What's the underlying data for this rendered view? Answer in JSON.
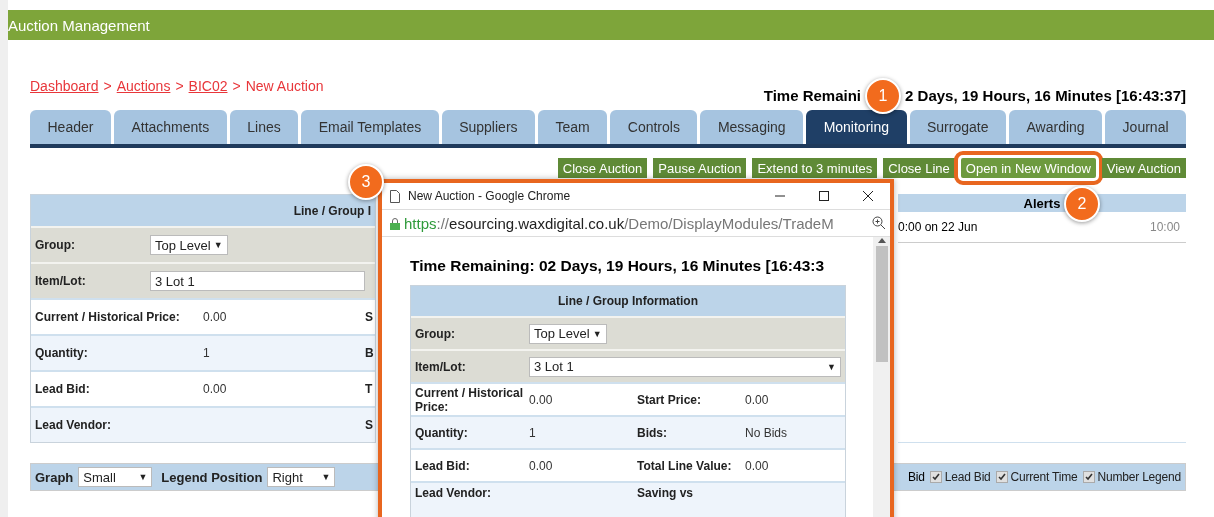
{
  "app_bar": {
    "title": "Auction Management"
  },
  "breadcrumb": [
    {
      "label": "Dashboard",
      "link": true
    },
    {
      "label": "Auctions",
      "link": true
    },
    {
      "label": "BIC02",
      "link": true
    },
    {
      "label": "New Auction",
      "link": false
    }
  ],
  "breadcrumb_separator": ">",
  "time_remaining": {
    "before_callout": "Time Remaini",
    "after_callout": "2 Days, 19 Hours, 16 Minutes [16:43:37]"
  },
  "tabs": [
    {
      "label": "Header",
      "selected": false
    },
    {
      "label": "Attachments",
      "selected": false
    },
    {
      "label": "Lines",
      "selected": false
    },
    {
      "label": "Email Templates",
      "selected": false
    },
    {
      "label": "Suppliers",
      "selected": false
    },
    {
      "label": "Team",
      "selected": false
    },
    {
      "label": "Controls",
      "selected": false
    },
    {
      "label": "Messaging",
      "selected": false
    },
    {
      "label": "Monitoring",
      "selected": true
    },
    {
      "label": "Surrogate",
      "selected": false
    },
    {
      "label": "Awarding",
      "selected": false
    },
    {
      "label": "Journal",
      "selected": false
    }
  ],
  "actions": [
    {
      "label": "Close Auction",
      "highlighted": false
    },
    {
      "label": "Pause Auction",
      "highlighted": false
    },
    {
      "label": "Extend to 3 minutes",
      "highlighted": false
    },
    {
      "label": "Close Line",
      "highlighted": false
    },
    {
      "label": "Open in New Window",
      "highlighted": true
    },
    {
      "label": "View Auction",
      "highlighted": false
    }
  ],
  "line_panel": {
    "title": "Line / Group I",
    "rows": [
      {
        "kind": "select",
        "label": "Group:",
        "value": "Top Level",
        "caret": "▼"
      },
      {
        "kind": "wide-select",
        "label": "Item/Lot:",
        "value": "3 Lot 1"
      },
      {
        "kind": "text",
        "label": "Current / Historical Price:",
        "value": "0.00",
        "column_3": "S"
      },
      {
        "kind": "text",
        "label": "Quantity:",
        "value": "1",
        "column_3": "B"
      },
      {
        "kind": "text",
        "label": "Lead Bid:",
        "value": "0.00",
        "column_3": "T"
      },
      {
        "kind": "text",
        "label": "Lead Vendor:",
        "column_3": "S"
      }
    ]
  },
  "alerts": {
    "title": "Alerts",
    "rows": [
      {
        "text": "0:00 on 22 Jun",
        "time": "10:00"
      }
    ]
  },
  "graph_bar": {
    "graph_label": "Graph",
    "graph_value": "Small",
    "legend_label": "Legend Position",
    "legend_value": "Right",
    "caret": "▼",
    "options": [
      {
        "kind": "label",
        "label": "Bid"
      },
      {
        "kind": "checkbox",
        "label": "Lead Bid",
        "checked": true
      },
      {
        "kind": "checkbox",
        "label": "Current Time",
        "checked": true
      },
      {
        "kind": "checkbox",
        "label": "Number Legend",
        "checked": true
      }
    ]
  },
  "popup": {
    "title": "New Auction - Google Chrome",
    "url": [
      {
        "kind": "scheme",
        "text": "https"
      },
      {
        "kind": "muted",
        "text": "://"
      },
      {
        "kind": "host",
        "text": "esourcing.waxdigital.co.uk"
      },
      {
        "kind": "muted",
        "text": "/Demo/DisplayModules/TradeM"
      }
    ],
    "time_remaining": "Time Remaining: 02 Days, 19 Hours, 16 Minutes [16:43:3",
    "table": {
      "title": "Line / Group Information",
      "rows": [
        {
          "kind": "select",
          "label": "Group:",
          "value": "Top Level",
          "caret": "▼"
        },
        {
          "kind": "wide-select",
          "label": "Item/Lot:",
          "value": "3 Lot 1",
          "caret": "▼"
        },
        {
          "kind": "pair",
          "label": "Current / Historical Price:",
          "value": "0.00",
          "label_2": "Start Price:",
          "value_2": "0.00"
        },
        {
          "kind": "pair",
          "label": "Quantity:",
          "value": "1",
          "label_2": "Bids:",
          "value_2": "No Bids"
        },
        {
          "kind": "pair",
          "label": "Lead Bid:",
          "value": "0.00",
          "label_2": "Total Line Value:",
          "value_2": "0.00"
        },
        {
          "kind": "pair",
          "label": "Lead Vendor:",
          "label_2": "Saving vs"
        }
      ]
    }
  },
  "callouts": [
    {
      "number": "1"
    },
    {
      "number": "2"
    },
    {
      "number": "3"
    }
  ]
}
